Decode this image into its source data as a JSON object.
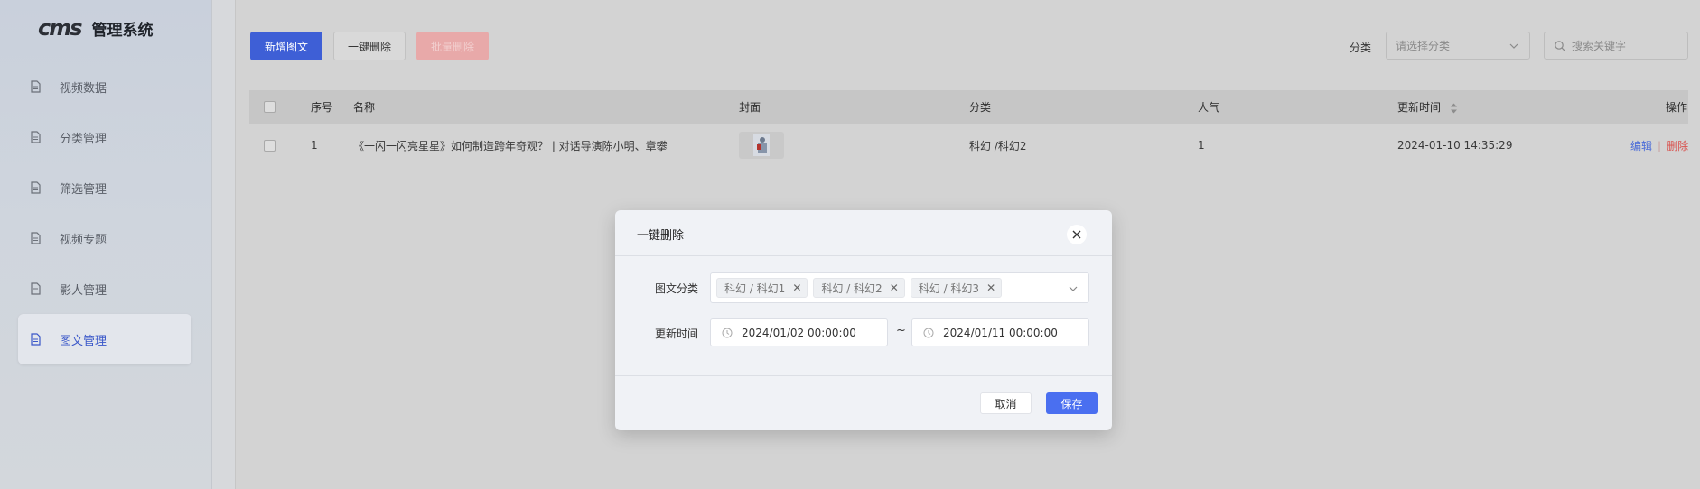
{
  "app": {
    "logo_mark": "cms",
    "title": "管理系统"
  },
  "sidebar": {
    "items": [
      {
        "label": "视频数据",
        "icon": "document-icon",
        "active": false
      },
      {
        "label": "分类管理",
        "icon": "document-icon",
        "active": false
      },
      {
        "label": "筛选管理",
        "icon": "document-icon",
        "active": false
      },
      {
        "label": "视频专题",
        "icon": "document-icon",
        "active": false
      },
      {
        "label": "影人管理",
        "icon": "document-icon",
        "active": false
      },
      {
        "label": "图文管理",
        "icon": "document-icon",
        "active": true
      }
    ]
  },
  "toolbar": {
    "add_label": "新增图文",
    "one_click_delete_label": "一键删除",
    "batch_delete_label": "批量删除",
    "category_label": "分类",
    "category_placeholder": "请选择分类",
    "search_placeholder": "搜索关键字"
  },
  "table": {
    "headers": {
      "index": "序号",
      "name": "名称",
      "cover": "封面",
      "category": "分类",
      "popularity": "人气",
      "updated": "更新时间",
      "actions": "操作"
    },
    "rows": [
      {
        "index": "1",
        "name": "《一闪一闪亮星星》如何制造跨年奇观？ | 对话导演陈小明、章攀",
        "category": "科幻 /科幻2",
        "popularity": "1",
        "updated": "2024-01-10 14:35:29",
        "edit_label": "编辑",
        "delete_label": "删除"
      }
    ]
  },
  "modal": {
    "title": "一键删除",
    "category_label": "图文分类",
    "tags": [
      "科幻 / 科幻1",
      "科幻 / 科幻2",
      "科幻 / 科幻3"
    ],
    "time_label": "更新时间",
    "start_date": "2024/01/02 00:00:00",
    "range_separator": "~",
    "end_date": "2024/01/11 00:00:00",
    "cancel_label": "取消",
    "save_label": "保存"
  },
  "colors": {
    "primary": "#3e5fd6",
    "danger": "#d9534f",
    "modal_save": "#4a6ff0"
  }
}
